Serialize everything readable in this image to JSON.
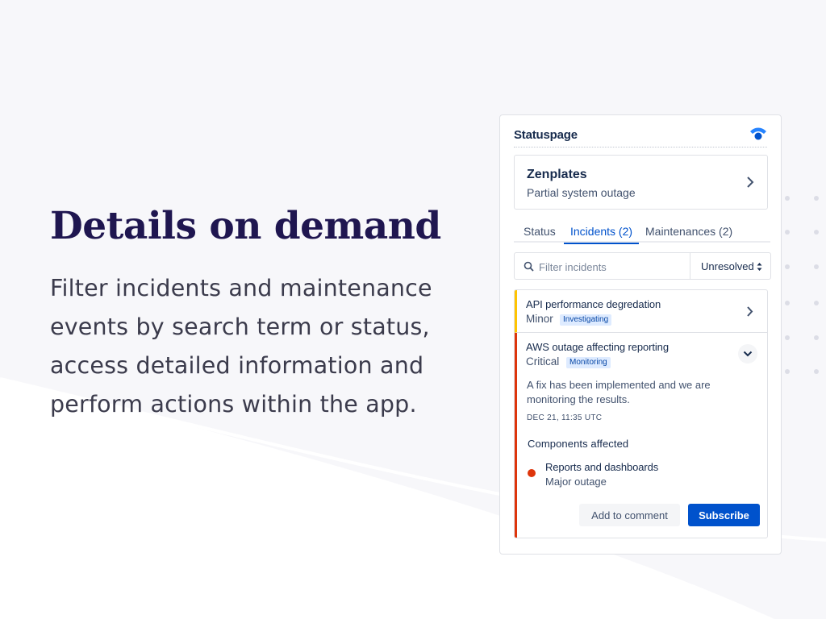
{
  "hero": {
    "title": "Details on demand",
    "description": "Filter incidents and maintenance events by search term or status, access detailed information and perform actions within the app."
  },
  "app": {
    "title": "Statuspage",
    "logo_icon": "statuspage-logo-icon",
    "accent_color": "#0052cc"
  },
  "page_card": {
    "name": "Zenplates",
    "status": "Partial system outage"
  },
  "tabs": [
    {
      "label": "Status",
      "active": false
    },
    {
      "label": "Incidents (2)",
      "active": true
    },
    {
      "label": "Maintenances (2)",
      "active": false
    }
  ],
  "filter": {
    "placeholder": "Filter incidents",
    "value": "",
    "status_selected": "Unresolved"
  },
  "incidents": [
    {
      "name": "API performance degredation",
      "impact": "Minor",
      "state": "Investigating",
      "impact_color": "#ffc400",
      "expanded": false
    },
    {
      "name": "AWS outage affecting reporting",
      "impact": "Critical",
      "state": "Monitoring",
      "impact_color": "#de350b",
      "expanded": true,
      "message": "A fix has been implemented and we are monitoring the results.",
      "timestamp": "DEC 21, 11:35 UTC",
      "components_heading": "Components affected",
      "components": [
        {
          "name": "Reports and dashboards",
          "status": "Major outage",
          "status_color": "#de350b"
        }
      ],
      "actions": {
        "secondary": "Add to comment",
        "primary": "Subscribe"
      }
    }
  ]
}
